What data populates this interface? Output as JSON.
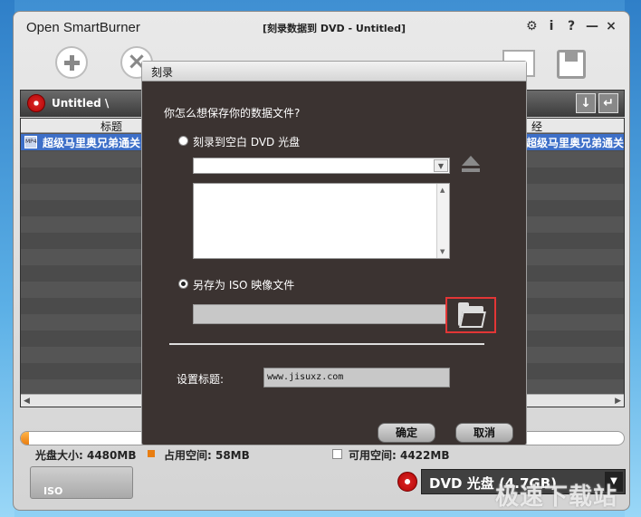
{
  "app": {
    "title": "Open SmartBurner",
    "window_title": "[刻录数据到 DVD - Untitled]",
    "window_buttons": [
      "⚙",
      "i",
      "?",
      "—",
      "×"
    ]
  },
  "project": {
    "name": "Untitled \\"
  },
  "file_list": {
    "col_title": "标题",
    "col_path": "经",
    "rows": [
      {
        "icon": "MP4",
        "title": "超级马里奥兄弟通关",
        "path": "超级马里奥兄弟通关"
      }
    ]
  },
  "capacity": {
    "disc_size": "光盘大小: 4480MB",
    "used": "占用空间: 58MB",
    "free": "可用空间: 4422MB",
    "used_fraction": 0.013
  },
  "bottom": {
    "iso_label": "ISO",
    "disc_type": "DVD 光盘 (4.7GB)",
    "watermark": "极速下载站"
  },
  "dialog": {
    "title": "刻录",
    "question": "你怎么想保存你的数据文件?",
    "option_burn": "刻录到空白 DVD 光盘",
    "option_iso": "另存为 ISO 映像文件",
    "selected": "iso",
    "title_label": "设置标题:",
    "title_value": "www.jisuxz.com",
    "ok": "确定",
    "cancel": "取消"
  }
}
